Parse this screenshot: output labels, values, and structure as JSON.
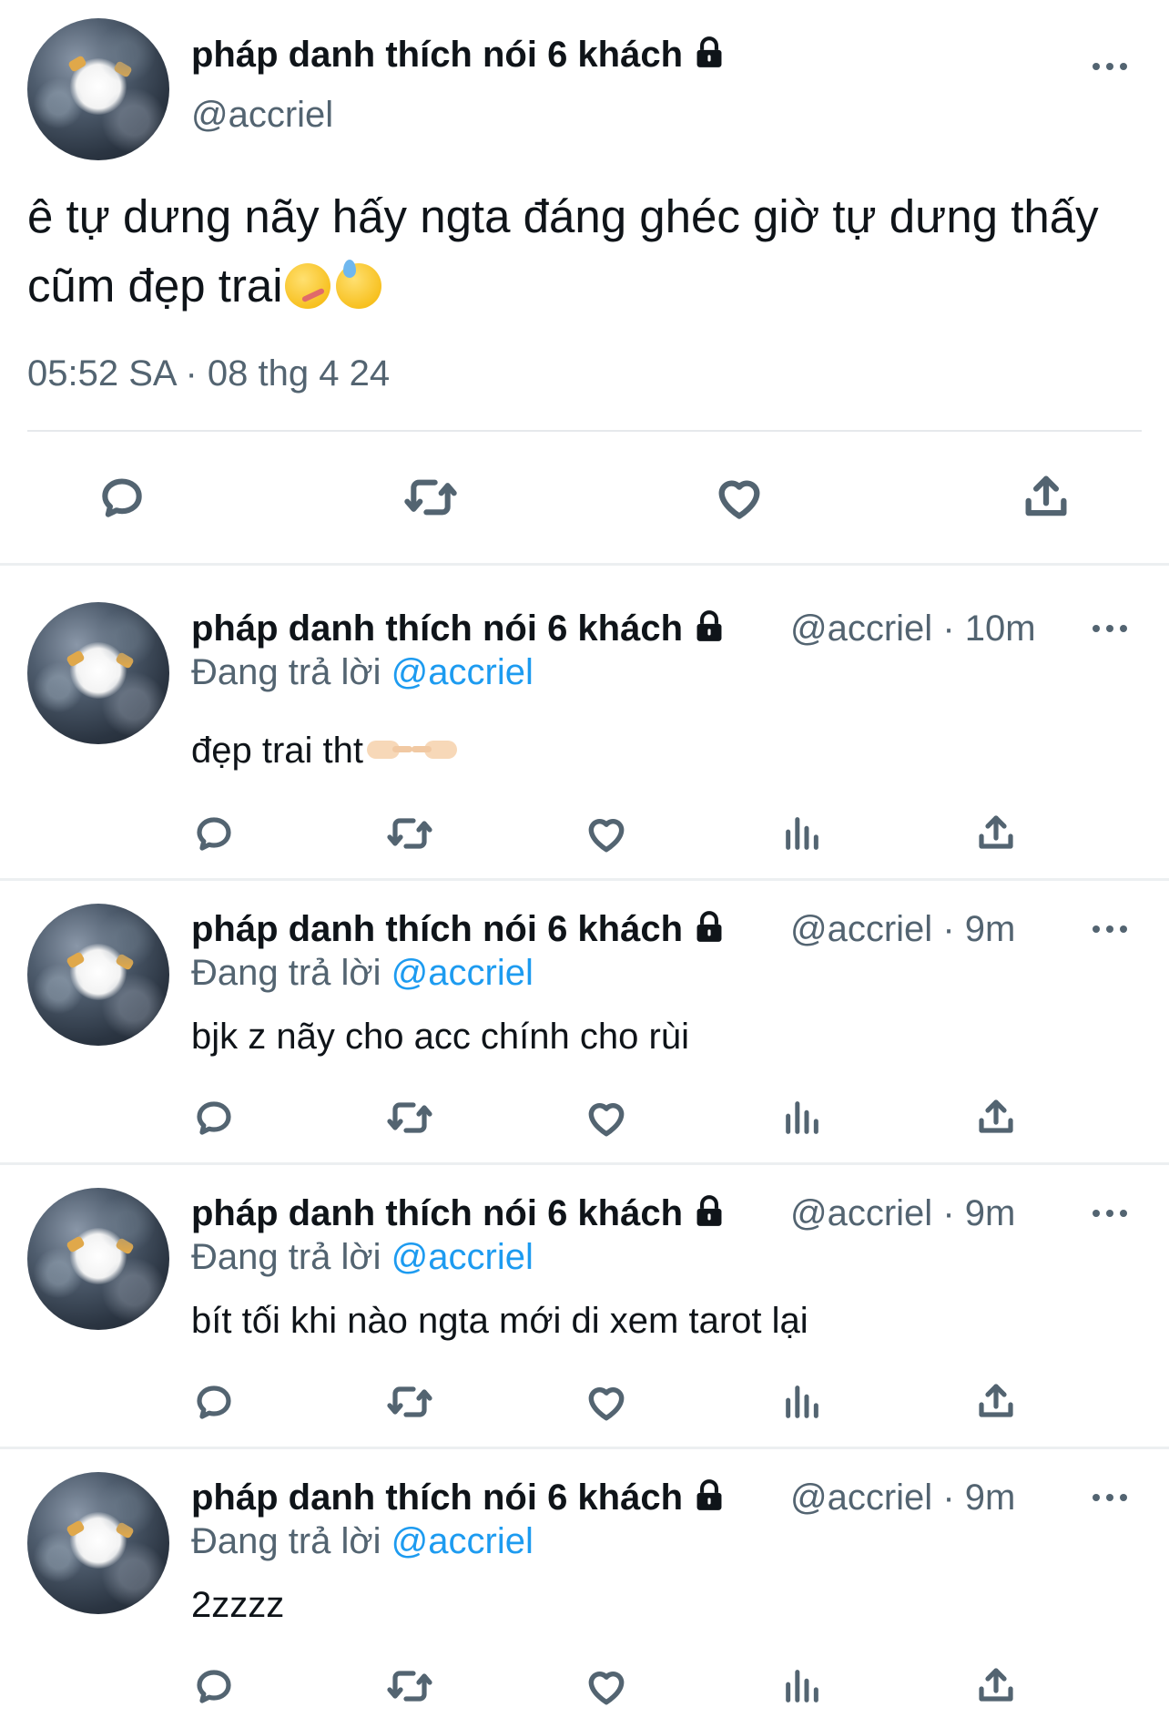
{
  "main_tweet": {
    "display_name": "pháp danh thích nói 6 khách",
    "handle": "@accriel",
    "text": "ê tự dưng nãy hấy ngta đáng ghéc giờ tự dưng thấy cũm đẹp trai",
    "emojis": [
      "face-with-thermometer",
      "downcast-face-with-sweat"
    ],
    "timestamp": "05:52 SA · 08 thg 4 24",
    "actions": [
      "reply-icon",
      "retweet-icon",
      "like-icon",
      "share-icon"
    ]
  },
  "replies": [
    {
      "display_name": "pháp danh thích nói 6 khách",
      "handle": "@accriel",
      "time": "10m",
      "replying_prefix": "Đang trả lời",
      "replying_to": "@accriel",
      "text": "đẹp trai tht",
      "emojis": [
        "backhand-index-pointing-right",
        "backhand-index-pointing-left"
      ]
    },
    {
      "display_name": "pháp danh thích nói 6 khách",
      "handle": "@accriel",
      "time": "9m",
      "replying_prefix": "Đang trả lời",
      "replying_to": "@accriel",
      "text": "bjk z nãy cho acc chính cho rùi"
    },
    {
      "display_name": "pháp danh thích nói 6 khách",
      "handle": "@accriel",
      "time": "9m",
      "replying_prefix": "Đang trả lời",
      "replying_to": "@accriel",
      "text": "bít tối khi nào ngta mới di xem tarot lại"
    },
    {
      "display_name": "pháp danh thích nói 6 khách",
      "handle": "@accriel",
      "time": "9m",
      "replying_prefix": "Đang trả lời",
      "replying_to": "@accriel",
      "text": "2zzzz"
    }
  ],
  "reply_actions": [
    "reply-icon",
    "retweet-icon",
    "like-icon",
    "views-icon",
    "share-icon"
  ],
  "colors": {
    "text": "#0f1419",
    "secondary": "#536471",
    "link": "#1d9bf0",
    "divider": "#e6e9ec"
  }
}
